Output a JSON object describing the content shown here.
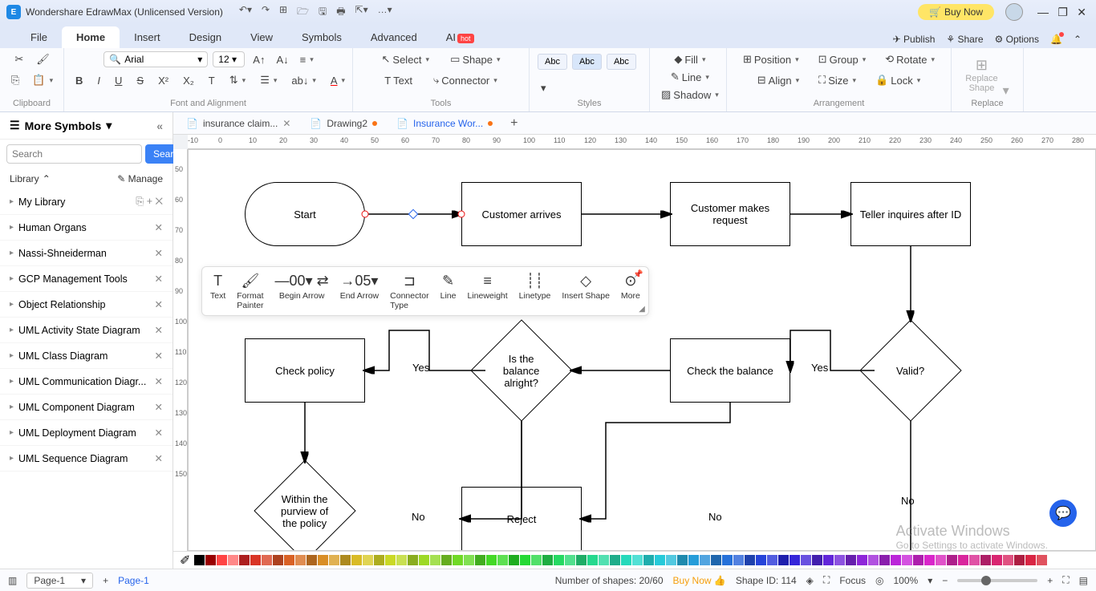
{
  "titlebar": {
    "app_name": "Wondershare EdrawMax (Unlicensed Version)",
    "buy_now": "Buy Now"
  },
  "menu": {
    "tabs": [
      "File",
      "Home",
      "Insert",
      "Design",
      "View",
      "Symbols",
      "Advanced",
      "AI"
    ],
    "active": "Home",
    "rlinks": {
      "publish": "Publish",
      "share": "Share",
      "options": "Options"
    }
  },
  "ribbon": {
    "groups": {
      "clipboard": "Clipboard",
      "font": "Font and Alignment",
      "tools": "Tools",
      "styles": "Styles",
      "arrangement": "Arrangement",
      "replace": "Replace"
    },
    "font_name": "Arial",
    "font_size": "12",
    "select": "Select",
    "shape": "Shape",
    "text": "Text",
    "connector": "Connector",
    "style_sample": "Abc",
    "fill": "Fill",
    "line": "Line",
    "shadow": "Shadow",
    "position": "Position",
    "align": "Align",
    "group": "Group",
    "size": "Size",
    "rotate": "Rotate",
    "lock": "Lock",
    "replace_shape": "Replace\nShape"
  },
  "leftpanel": {
    "title": "More Symbols",
    "search_placeholder": "Search",
    "search_btn": "Search",
    "library_lbl": "Library",
    "manage_lbl": "Manage",
    "items": [
      "My Library",
      "Human Organs",
      "Nassi-Shneiderman",
      "GCP Management Tools",
      "Object Relationship",
      "UML Activity State Diagram",
      "UML Class Diagram",
      "UML Communication Diagr...",
      "UML Component Diagram",
      "UML Deployment Diagram",
      "UML Sequence Diagram"
    ]
  },
  "doctabs": {
    "tabs": [
      {
        "label": "insurance claim...",
        "active": false,
        "dirty": false,
        "closable": true
      },
      {
        "label": "Drawing2",
        "active": false,
        "dirty": true,
        "closable": false
      },
      {
        "label": "Insurance Wor...",
        "active": true,
        "dirty": true,
        "closable": false
      }
    ]
  },
  "ruler_h": [
    "-10",
    "0",
    "10",
    "20",
    "30",
    "40",
    "50",
    "60",
    "70",
    "80",
    "90",
    "100",
    "110",
    "120",
    "130",
    "140",
    "150",
    "160",
    "170",
    "180",
    "190",
    "200",
    "210",
    "220",
    "230",
    "240",
    "250",
    "260",
    "270",
    "280"
  ],
  "ruler_v": [
    "50",
    "60",
    "70",
    "80",
    "90",
    "100",
    "110",
    "120",
    "130",
    "140",
    "150"
  ],
  "flowchart": {
    "start": "Start",
    "customer_arrives": "Customer arrives",
    "customer_request": "Customer makes request",
    "teller_inquires": "Teller inquires after ID",
    "valid": "Valid?",
    "check_balance": "Check the balance",
    "balance_alright": "Is the balance alright?",
    "check_policy": "Check policy",
    "within_purview": "Within the purview of the policy",
    "reject": "Reject",
    "yes1": "Yes",
    "yes2": "Yes",
    "no1": "No",
    "no2": "No",
    "no3": "No"
  },
  "ctx_toolbar": {
    "text": "Text",
    "format_painter": "Format\nPainter",
    "begin_arrow": "Begin Arrow",
    "begin_val": "00",
    "end_arrow": "End Arrow",
    "end_val": "05",
    "connector_type": "Connector\nType",
    "line": "Line",
    "lineweight": "Lineweight",
    "linetype": "Linetype",
    "insert_shape": "Insert Shape",
    "more": "More"
  },
  "statusbar": {
    "page_sel": "Page-1",
    "page_tab": "Page-1",
    "shapes": "Number of shapes: 20/60",
    "buynow": "Buy Now",
    "shapeid": "Shape ID: 114",
    "focus": "Focus",
    "zoom": "100%"
  },
  "activate": {
    "l1": "Activate Windows",
    "l2": "Go to Settings to activate Windows."
  }
}
